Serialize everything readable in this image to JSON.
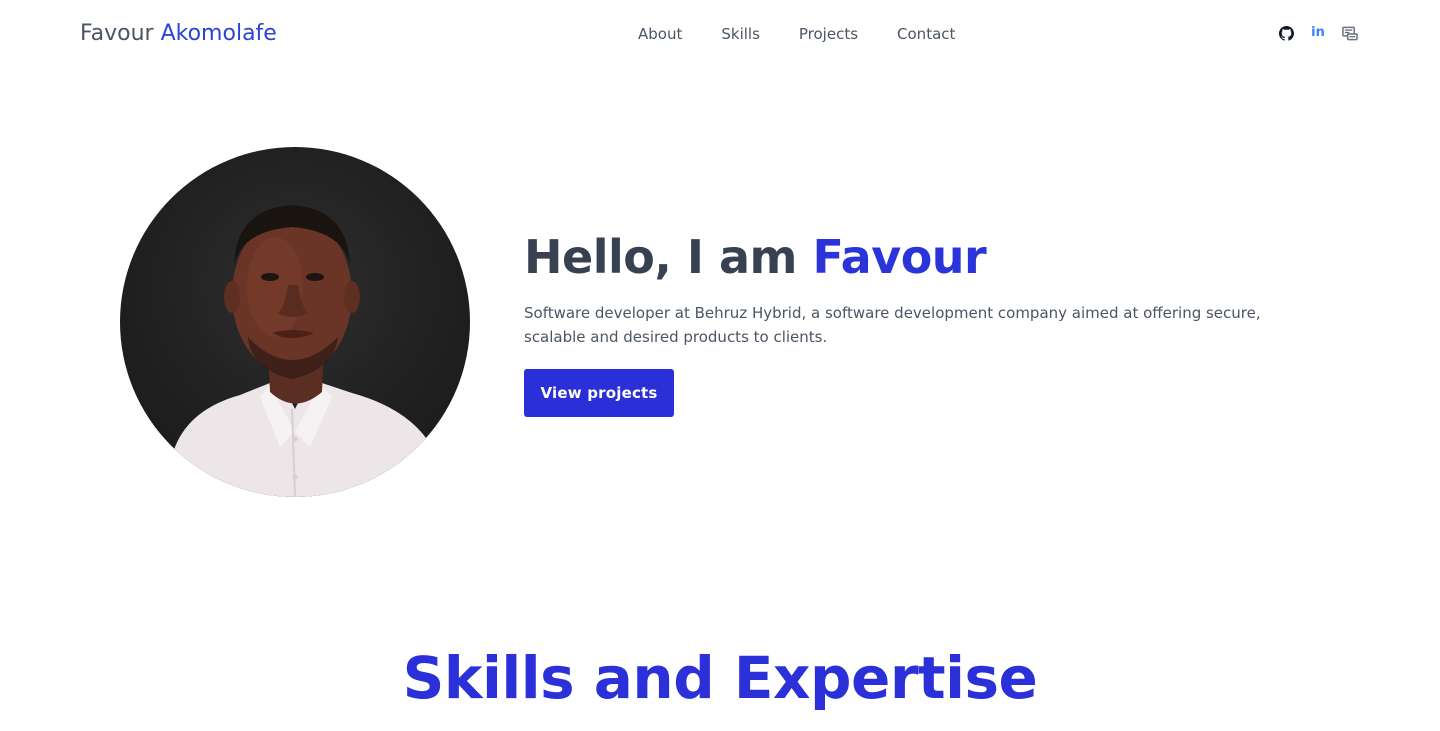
{
  "header": {
    "brand_first": "Favour",
    "brand_last": "Akomolafe",
    "nav": [
      {
        "label": "About"
      },
      {
        "label": "Skills"
      },
      {
        "label": "Projects"
      },
      {
        "label": "Contact"
      }
    ],
    "socials": [
      {
        "icon": "github-icon"
      },
      {
        "icon": "linkedin-icon",
        "text": "in"
      },
      {
        "icon": "blog-icon"
      }
    ]
  },
  "hero": {
    "greeting": "Hello, I am ",
    "name": "Favour",
    "description": "Software developer at Behruz Hybrid, a software development company aimed at offering secure, scalable and desired products to clients.",
    "cta_label": "View projects"
  },
  "skills": {
    "title": "Skills and Expertise"
  },
  "colors": {
    "accent": "#2b34d9",
    "text": "#374151",
    "muted": "#4b5563",
    "linkedin": "#3b82f6"
  }
}
